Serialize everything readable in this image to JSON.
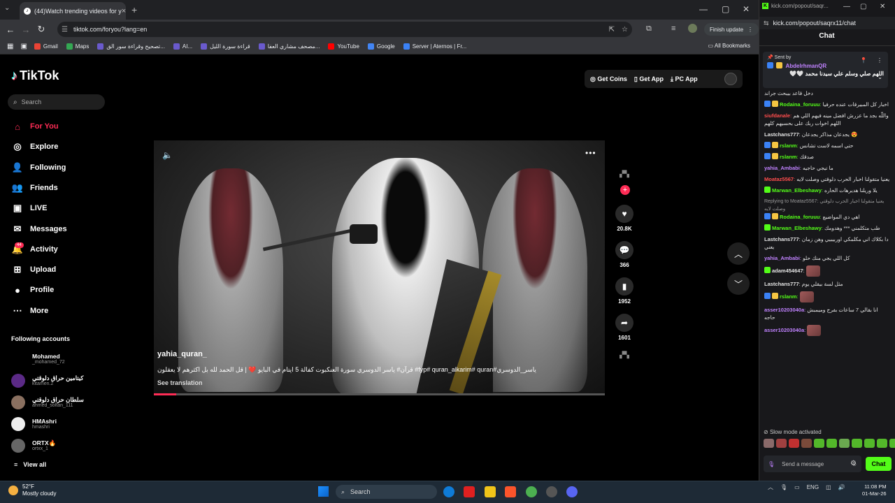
{
  "browser": {
    "tab_title": "(44)Watch trending videos for y",
    "new_tab": "+",
    "address": "tiktok.com/foryou?lang=en",
    "finish_update": "Finish update",
    "bookmarks": [
      {
        "label": "Gmail",
        "color": "#ea4335"
      },
      {
        "label": "Maps",
        "color": "#34a853"
      },
      {
        "label": "تصحيح وقراءة سور الق...",
        "color": "#6a5acd"
      },
      {
        "label": "AI...",
        "color": "#6a5acd"
      },
      {
        "label": "قراءة سورة الليل",
        "color": "#6a5acd"
      },
      {
        "label": "مصحف مشاري العفا...",
        "color": "#6a5acd"
      },
      {
        "label": "YouTube",
        "color": "#ff0000"
      },
      {
        "label": "Google",
        "color": "#4285f4"
      },
      {
        "label": "Server | Aternos | Fr...",
        "color": "#3b82f6"
      }
    ],
    "all_bookmarks": "All Bookmarks"
  },
  "tiktok": {
    "logo": "TikTok",
    "search_placeholder": "Search",
    "nav": [
      {
        "label": "For You",
        "icon": "home-icon",
        "active": true
      },
      {
        "label": "Explore",
        "icon": "compass-icon"
      },
      {
        "label": "Following",
        "icon": "following-icon"
      },
      {
        "label": "Friends",
        "icon": "friends-icon"
      },
      {
        "label": "LIVE",
        "icon": "live-icon"
      },
      {
        "label": "Messages",
        "icon": "messages-icon"
      },
      {
        "label": "Activity",
        "icon": "activity-icon"
      },
      {
        "label": "Upload",
        "icon": "upload-icon"
      },
      {
        "label": "Profile",
        "icon": "profile-icon"
      },
      {
        "label": "More",
        "icon": "more-icon"
      }
    ],
    "activity_badge": "44",
    "following_title": "Following accounts",
    "following": [
      {
        "name": "Mohamed",
        "user": "_mohamed_72",
        "color": "#000"
      },
      {
        "name": "كيتامين حراق دلوقتي",
        "user": "kitamen.2",
        "color": "#5b2a86"
      },
      {
        "name": "سلطان حراق دلوقتي",
        "user": "ahmed_soltan_111",
        "color": "#8a7060"
      },
      {
        "name": "HMAshri",
        "user": "hmashri",
        "color": "#eeeeee"
      },
      {
        "name": "ORTX🔥",
        "user": "ortxx_1",
        "color": "#666"
      }
    ],
    "view_all": "View all",
    "top_buttons": [
      "Get Coins",
      "Get App",
      "PC App"
    ],
    "video": {
      "username": "yahia_quran_",
      "caption": "ياسر_الدوسري#fyp# quran_alkarim# quran# قرآن# ياسر الدوسري سورة العنكبوت كفالة 5 ايتام في البايو ❤️ | قل الحمد لله بل اكثرهم لا يعقلون",
      "see_translation": "See translation",
      "progress": 0.05
    },
    "actions": {
      "likes": "20.8K",
      "comments": "366",
      "saves": "1952",
      "shares": "1601"
    }
  },
  "kick": {
    "title": "kick.com/popout/saqr...",
    "url": "kick.com/popout/saqrx11/chat",
    "chat_header": "Chat",
    "pinned": {
      "label": "Sent by",
      "user": "AbdelrhmanQR",
      "text": "اللهم صلي وسلم علي سيدنا محمد 🤍🤍"
    },
    "messages": [
      {
        "user": "",
        "text": "دخل قاعد بيبحث جراند",
        "color": "#e4e4e4",
        "badges": 0
      },
      {
        "user": "Rodaina_foruuu",
        "text": "اخبار كل المبيرقات عنده حرفيا",
        "color": "#53fc18",
        "badges": 2
      },
      {
        "user": "siufdanale",
        "text": "واللّه بجد ما عزرش افضل مينه فيهم اللي هم اللهم اخوات ربك على بحسيهم كلهم",
        "color": "#ff4d4d",
        "badges": 0
      },
      {
        "user": "Lastchans777",
        "text": "يجدعان مذاكر يجدعان 😍",
        "color": "#e4e4e4",
        "badges": 0
      },
      {
        "user": "rslanm",
        "text": "حتي اسمه لاست تشانس",
        "color": "#53fc18",
        "badges": 2
      },
      {
        "user": "rslanm",
        "text": "صدقك",
        "color": "#53fc18",
        "badges": 2
      },
      {
        "user": "yahia_Ambabi",
        "text": "ما تيجي حاجيه",
        "color": "#c082ff",
        "badges": 0
      },
      {
        "user": "Moataz5567",
        "text": "يعنيا متقولنا اخبار الحرب دلوقتي وصلت لايه",
        "color": "#ff4d4d",
        "badges": 0
      },
      {
        "user": "Marwan_Elbeshawy",
        "text": "يلا وريلنا هديرهات الحاره",
        "color": "#53fc18",
        "badges": 1
      },
      {
        "user": "Rodaina_foruuu",
        "text": "اهي دي المواضيع",
        "color": "#53fc18",
        "badges": 2,
        "reply": "Replying to Moataz5567: يعنيا متقولنا اخبار الحرب دلوقتي وصلت لايه"
      },
      {
        "user": "Marwan_Elbeshawy",
        "text": "طب متكلمني *** وهدومك",
        "color": "#53fc18",
        "badges": 1
      },
      {
        "user": "Lastchans777",
        "text": "دا بكلاك اني مكلمكي اوربيبيي وهن زمان يعني",
        "color": "#e4e4e4",
        "badges": 0
      },
      {
        "user": "yahia_Ambabi",
        "text": "كل اللي يجي منك حلو",
        "color": "#c082ff",
        "badges": 0
      },
      {
        "user": "adam454647",
        "text": "",
        "color": "#e4e4e4",
        "badges": 1,
        "emote": true
      },
      {
        "user": "Lastchans777",
        "text": "مثل لسة بيقلي يوم",
        "color": "#e4e4e4",
        "badges": 0
      },
      {
        "user": "rslanm",
        "text": "",
        "color": "#53fc18",
        "badges": 2,
        "emote": true
      },
      {
        "user": "asser10203040a",
        "text": "انا بقالي 7 ساعات بفرج وميمبش حاجه",
        "color": "#c082ff",
        "badges": 0
      },
      {
        "user": "asser10203040a",
        "text": "",
        "color": "#c082ff",
        "badges": 0,
        "emote": true
      }
    ],
    "slow_mode": "Slow mode activated",
    "input_placeholder": "Send a message",
    "chat_button": "Chat"
  },
  "taskbar": {
    "temp": "52°F",
    "weather": "Mostly cloudy",
    "search": "Search",
    "lang": "ENG",
    "time": "11:08 PM",
    "date": "01-Mar-26"
  }
}
